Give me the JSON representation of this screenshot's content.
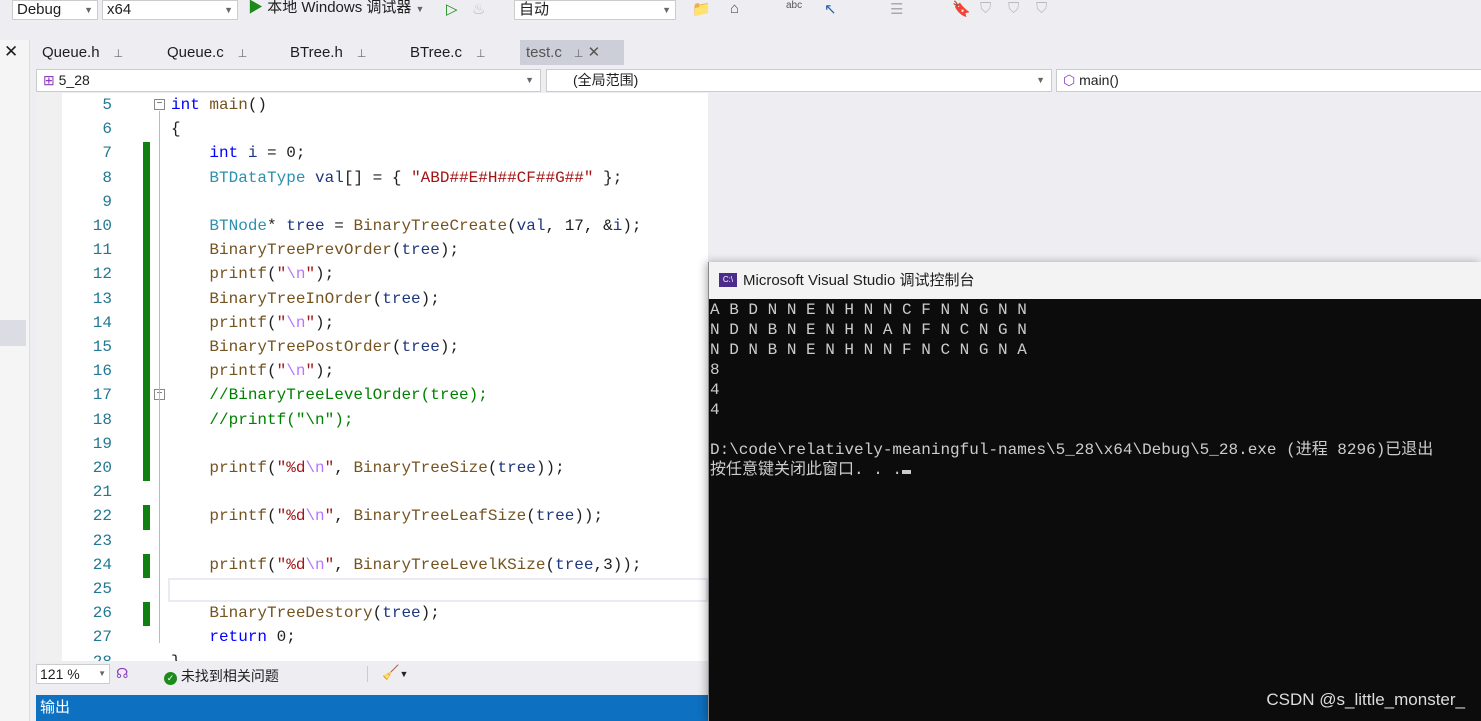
{
  "toolbar": {
    "config": "Debug",
    "platform": "x64",
    "run_label": "本地 Windows 调试器",
    "solution_config": "自动"
  },
  "tabs": [
    {
      "label": "Queue.h"
    },
    {
      "label": "Queue.c"
    },
    {
      "label": "BTree.h"
    },
    {
      "label": "BTree.c"
    },
    {
      "label": "test.c",
      "active": true
    }
  ],
  "navbar": {
    "project": "5_28",
    "scope": "(全局范围)",
    "member": "main()"
  },
  "editor": {
    "first_line": 5,
    "changed_lines": [
      7,
      8,
      9,
      10,
      11,
      12,
      13,
      14,
      15,
      16,
      17,
      18,
      19,
      20,
      22,
      24,
      26
    ],
    "current_line": 25,
    "lines": [
      [
        [
          "kw",
          "int"
        ],
        [
          "pl",
          " "
        ],
        [
          "fn",
          "main"
        ],
        [
          "pl",
          "()"
        ]
      ],
      [
        [
          "pl",
          "{"
        ]
      ],
      [
        [
          "pl",
          "    "
        ],
        [
          "kw",
          "int"
        ],
        [
          "pl",
          " "
        ],
        [
          "vr",
          "i"
        ],
        [
          "pl",
          " = 0;"
        ]
      ],
      [
        [
          "pl",
          "    "
        ],
        [
          "ty",
          "BTDataType"
        ],
        [
          "pl",
          " "
        ],
        [
          "vr",
          "val"
        ],
        [
          "pl",
          "[] = { "
        ],
        [
          "st",
          "\"ABD##E#H##CF##G##\""
        ],
        [
          "pl",
          " };"
        ]
      ],
      [],
      [
        [
          "pl",
          "    "
        ],
        [
          "ty",
          "BTNode"
        ],
        [
          "pl",
          "* "
        ],
        [
          "vr",
          "tree"
        ],
        [
          "pl",
          " = "
        ],
        [
          "fn",
          "BinaryTreeCreate"
        ],
        [
          "pl",
          "("
        ],
        [
          "vr",
          "val"
        ],
        [
          "pl",
          ", 17, &"
        ],
        [
          "vr",
          "i"
        ],
        [
          "pl",
          ");"
        ]
      ],
      [
        [
          "pl",
          "    "
        ],
        [
          "fn",
          "BinaryTreePrevOrder"
        ],
        [
          "pl",
          "("
        ],
        [
          "vr",
          "tree"
        ],
        [
          "pl",
          ");"
        ]
      ],
      [
        [
          "pl",
          "    "
        ],
        [
          "fn",
          "printf"
        ],
        [
          "pl",
          "("
        ],
        [
          "st",
          "\""
        ],
        [
          "es",
          "\\n"
        ],
        [
          "st",
          "\""
        ],
        [
          "pl",
          ");"
        ]
      ],
      [
        [
          "pl",
          "    "
        ],
        [
          "fn",
          "BinaryTreeInOrder"
        ],
        [
          "pl",
          "("
        ],
        [
          "vr",
          "tree"
        ],
        [
          "pl",
          ");"
        ]
      ],
      [
        [
          "pl",
          "    "
        ],
        [
          "fn",
          "printf"
        ],
        [
          "pl",
          "("
        ],
        [
          "st",
          "\""
        ],
        [
          "es",
          "\\n"
        ],
        [
          "st",
          "\""
        ],
        [
          "pl",
          ");"
        ]
      ],
      [
        [
          "pl",
          "    "
        ],
        [
          "fn",
          "BinaryTreePostOrder"
        ],
        [
          "pl",
          "("
        ],
        [
          "vr",
          "tree"
        ],
        [
          "pl",
          ");"
        ]
      ],
      [
        [
          "pl",
          "    "
        ],
        [
          "fn",
          "printf"
        ],
        [
          "pl",
          "("
        ],
        [
          "st",
          "\""
        ],
        [
          "es",
          "\\n"
        ],
        [
          "st",
          "\""
        ],
        [
          "pl",
          ");"
        ]
      ],
      [
        [
          "pl",
          "    "
        ],
        [
          "cm",
          "//BinaryTreeLevelOrder(tree);"
        ]
      ],
      [
        [
          "pl",
          "    "
        ],
        [
          "cm",
          "//printf(\"\\n\");"
        ]
      ],
      [],
      [
        [
          "pl",
          "    "
        ],
        [
          "fn",
          "printf"
        ],
        [
          "pl",
          "("
        ],
        [
          "st",
          "\"%d"
        ],
        [
          "es",
          "\\n"
        ],
        [
          "st",
          "\""
        ],
        [
          "pl",
          ", "
        ],
        [
          "fn",
          "BinaryTreeSize"
        ],
        [
          "pl",
          "("
        ],
        [
          "vr",
          "tree"
        ],
        [
          "pl",
          "));"
        ]
      ],
      [],
      [
        [
          "pl",
          "    "
        ],
        [
          "fn",
          "printf"
        ],
        [
          "pl",
          "("
        ],
        [
          "st",
          "\"%d"
        ],
        [
          "es",
          "\\n"
        ],
        [
          "st",
          "\""
        ],
        [
          "pl",
          ", "
        ],
        [
          "fn",
          "BinaryTreeLeafSize"
        ],
        [
          "pl",
          "("
        ],
        [
          "vr",
          "tree"
        ],
        [
          "pl",
          "));"
        ]
      ],
      [],
      [
        [
          "pl",
          "    "
        ],
        [
          "fn",
          "printf"
        ],
        [
          "pl",
          "("
        ],
        [
          "st",
          "\"%d"
        ],
        [
          "es",
          "\\n"
        ],
        [
          "st",
          "\""
        ],
        [
          "pl",
          ", "
        ],
        [
          "fn",
          "BinaryTreeLevelKSize"
        ],
        [
          "pl",
          "("
        ],
        [
          "vr",
          "tree"
        ],
        [
          "pl",
          ",3));"
        ]
      ],
      [],
      [
        [
          "pl",
          "    "
        ],
        [
          "fn",
          "BinaryTreeDestory"
        ],
        [
          "pl",
          "("
        ],
        [
          "vr",
          "tree"
        ],
        [
          "pl",
          ");"
        ]
      ],
      [
        [
          "pl",
          "    "
        ],
        [
          "kw",
          "return"
        ],
        [
          "pl",
          " 0;"
        ]
      ],
      [
        [
          "pl",
          "}"
        ]
      ]
    ]
  },
  "status": {
    "zoom": "121 %",
    "issues": "未找到相关问题"
  },
  "output_panel": {
    "title": "输出"
  },
  "console": {
    "title": "Microsoft Visual Studio 调试控制台",
    "icon_text": "C:\\",
    "lines": [
      "A B D N N E N H N N C F N N G N N",
      "N D N B N E N H N A N F N C N G N",
      "N D N B N E N H N N F N C N G N A",
      "8",
      "4",
      "4",
      "",
      "D:\\code\\relatively-meaningful-names\\5_28\\x64\\Debug\\5_28.exe (进程 8296)已退出",
      "按任意键关闭此窗口. . ."
    ]
  },
  "watermark": "CSDN @s_little_monster_"
}
